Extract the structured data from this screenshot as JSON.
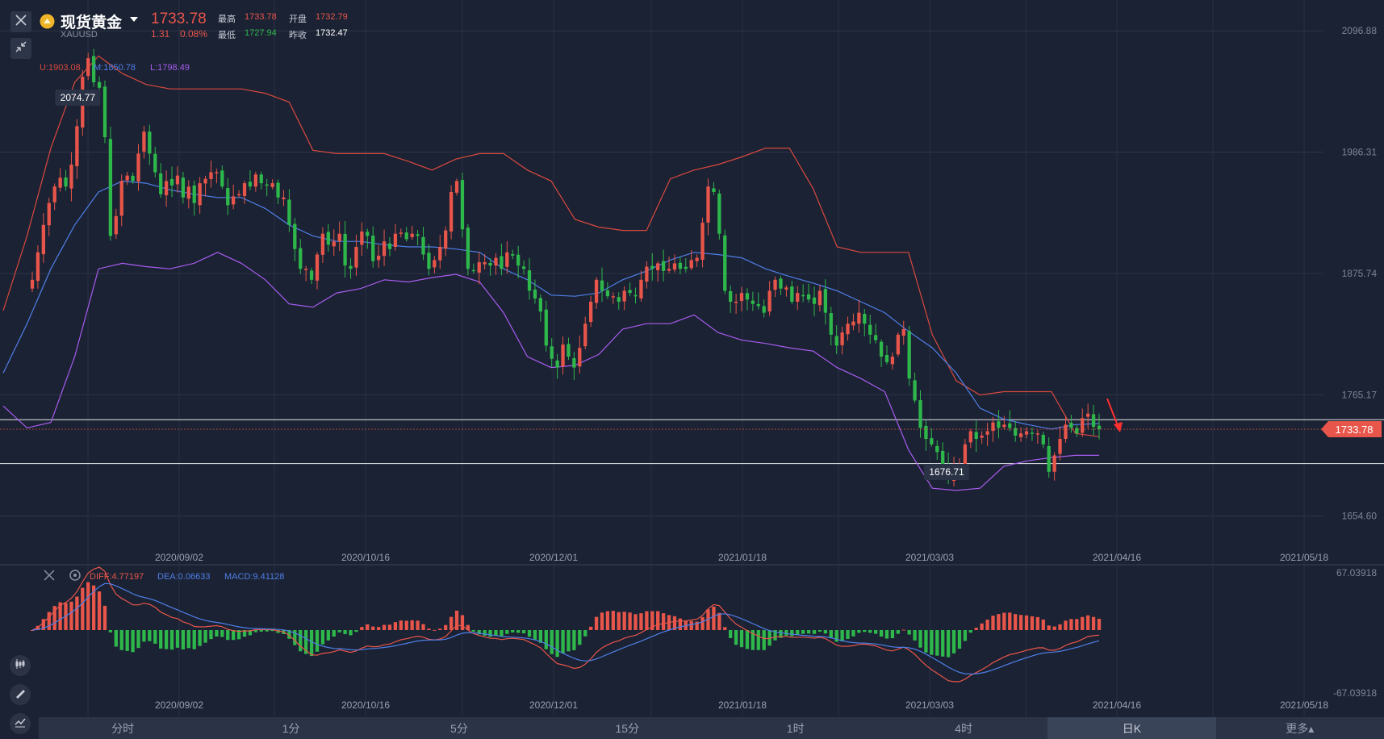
{
  "header": {
    "symbol_name": "现货黄金",
    "symbol_code": "XAUUSD",
    "price": "1733.78",
    "change": "1.31",
    "change_pct": "0.08%",
    "high_label": "最高",
    "high_value": "1733.78",
    "low_label": "最低",
    "low_value": "1727.94",
    "open_label": "开盘",
    "open_value": "1732.79",
    "prev_label": "昨收",
    "prev_value": "1732.47"
  },
  "boll": {
    "u": "U:1903.08",
    "m": "M:1850.78",
    "l": "L:1798.49"
  },
  "macd": {
    "diff": "DIFF:4.77197",
    "dea": "DEA:0.06633",
    "macd": "MACD:9.41128"
  },
  "tabs": [
    "分时",
    "1分",
    "5分",
    "15分",
    "1时",
    "4时",
    "日K",
    "更多▴"
  ],
  "active_tab": 6,
  "colors": {
    "up": "#e8554a",
    "down": "#2eb84b",
    "upper_band": "#d9493f",
    "mid_band": "#4f7fe8",
    "lower_band": "#a85cf0",
    "background": "#1b2233"
  },
  "chart_data": [
    {
      "type": "candlestick",
      "x_ticks": [
        "2020/09/02",
        "2020/10/16",
        "2020/12/01",
        "2021/01/18",
        "2021/03/03",
        "2021/04/16",
        "2021/05/18"
      ],
      "y_ticks": [
        2096.88,
        1986.31,
        1875.74,
        1765.17,
        1654.6
      ],
      "ylim": [
        1625,
        2125
      ],
      "current_price": 1733.78,
      "max_label": "2074.77",
      "min_label": "1676.71",
      "horizontal_lines": [
        1742.5,
        1702.5
      ],
      "close": [
        1870,
        1895,
        1920,
        1940,
        1955,
        1963,
        1955,
        1975,
        2010,
        2055,
        2072,
        2050,
        2045,
        2000,
        1910,
        1928,
        1960,
        1965,
        1960,
        1985,
        2005,
        1985,
        1968,
        1948,
        1960,
        1956,
        1965,
        1945,
        1955,
        1940,
        1958,
        1962,
        1968,
        1968,
        1955,
        1938,
        1946,
        1948,
        1958,
        1955,
        1966,
        1958,
        1956,
        1958,
        1945,
        1945,
        1920,
        1898,
        1880,
        1880,
        1870,
        1893,
        1912,
        1902,
        1905,
        1912,
        1883,
        1880,
        1900,
        1914,
        1910,
        1887,
        1892,
        1905,
        1898,
        1912,
        1913,
        1907,
        1912,
        1910,
        1893,
        1880,
        1888,
        1900,
        1915,
        1950,
        1960,
        1916,
        1880,
        1878,
        1886,
        1886,
        1883,
        1890,
        1880,
        1895,
        1892,
        1883,
        1880,
        1860,
        1853,
        1841,
        1810,
        1798,
        1790,
        1811,
        1800,
        1790,
        1808,
        1830,
        1850,
        1870,
        1860,
        1855,
        1855,
        1850,
        1860,
        1858,
        1855,
        1870,
        1882,
        1880,
        1885,
        1878,
        1880,
        1885,
        1880,
        1880,
        1888,
        1890,
        1922,
        1955,
        1950,
        1912,
        1860,
        1850,
        1850,
        1858,
        1852,
        1848,
        1846,
        1840,
        1860,
        1870,
        1862,
        1863,
        1850,
        1858,
        1856,
        1852,
        1848,
        1860,
        1840,
        1820,
        1810,
        1822,
        1830,
        1832,
        1840,
        1830,
        1820,
        1815,
        1800,
        1795,
        1800,
        1820,
        1825,
        1780,
        1760,
        1735,
        1725,
        1720,
        1713,
        1700,
        1688,
        1700,
        1702,
        1720,
        1732,
        1725,
        1728,
        1732,
        1740,
        1735,
        1738,
        1735,
        1728,
        1730,
        1732,
        1730,
        1730,
        1720,
        1695,
        1710,
        1725,
        1738,
        1735,
        1730,
        1744,
        1748,
        1736,
        1733.78
      ],
      "bollinger_upper": [
        1842,
        1910,
        1990,
        2050,
        2074,
        2058,
        2048,
        2044,
        2044,
        2044,
        2044,
        2040,
        2032,
        1988,
        1985,
        1985,
        1985,
        1978,
        1970,
        1980,
        1985,
        1985,
        1970,
        1960,
        1925,
        1918,
        1915,
        1915,
        1962,
        1970,
        1975,
        1982,
        1990,
        1990,
        1953,
        1900,
        1895,
        1895,
        1895,
        1820,
        1778,
        1765,
        1768,
        1768,
        1768,
        1730,
        1727
      ],
      "bollinger_mid": [
        1785,
        1830,
        1880,
        1920,
        1950,
        1960,
        1958,
        1952,
        1948,
        1945,
        1945,
        1935,
        1920,
        1910,
        1905,
        1905,
        1902,
        1900,
        1900,
        1898,
        1895,
        1880,
        1870,
        1856,
        1855,
        1858,
        1870,
        1878,
        1888,
        1895,
        1893,
        1890,
        1880,
        1873,
        1867,
        1860,
        1850,
        1840,
        1823,
        1808,
        1785,
        1753,
        1743,
        1738,
        1734,
        1738,
        1739
      ],
      "bollinger_lower": [
        1755,
        1735,
        1740,
        1800,
        1880,
        1885,
        1882,
        1880,
        1885,
        1895,
        1885,
        1870,
        1848,
        1845,
        1858,
        1862,
        1870,
        1868,
        1872,
        1875,
        1868,
        1840,
        1800,
        1790,
        1792,
        1802,
        1825,
        1830,
        1830,
        1838,
        1822,
        1815,
        1812,
        1808,
        1805,
        1790,
        1780,
        1768,
        1715,
        1680,
        1678,
        1680,
        1700,
        1705,
        1708,
        1710,
        1710
      ],
      "series": [
        {
          "name": "U:1903.08"
        },
        {
          "name": "M:1850.78"
        },
        {
          "name": "L:1798.49"
        }
      ]
    },
    {
      "type": "macd",
      "ylim": [
        -67.03918,
        67.03918
      ],
      "y_ticks": [
        "67.03918",
        "-67.03918"
      ],
      "x_ticks": [
        "2020/09/02",
        "2020/10/16",
        "2020/12/01",
        "2021/01/18",
        "2021/03/03",
        "2021/04/16",
        "2021/05/18"
      ],
      "series": [
        {
          "name": "DIFF:4.77197"
        },
        {
          "name": "DEA:0.06633"
        },
        {
          "name": "MACD:9.41128"
        }
      ]
    }
  ]
}
